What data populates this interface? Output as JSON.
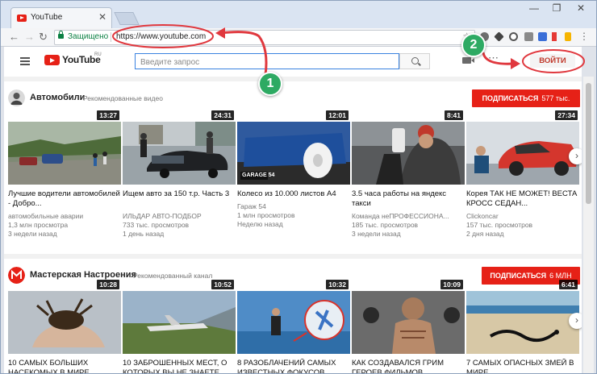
{
  "browser": {
    "tab_title": "YouTube",
    "secure_label": "Защищено",
    "url": "https://www.youtube.com",
    "window_controls": [
      "—",
      "❐",
      "✕"
    ]
  },
  "youtube": {
    "logo_text": "YouTube",
    "logo_region": "RU",
    "search_placeholder": "Введите запрос",
    "signin_label": "ВОЙТИ"
  },
  "sections": [
    {
      "title": "Автомобили",
      "subtitle": "Рекомендованные видео",
      "subscribe_label": "ПОДПИСАТЬСЯ",
      "subscriber_count": "577 тыс.",
      "videos": [
        {
          "title": "Лучшие водители автомобилей - Добро...",
          "channel": "автомобильные аварии",
          "views": "1,3 млн просмотра",
          "age": "3 недели назад",
          "duration": "13:27"
        },
        {
          "title": "Ищем авто за 150 т.р. Часть 3",
          "channel": "ИЛЬДАР АВТО-ПОДБОР",
          "views": "733 тыс. просмотров",
          "age": "1 день назад",
          "duration": "24:31"
        },
        {
          "title": "Колесо из 10.000 листов А4",
          "channel": "Гараж 54",
          "views": "1 млн просмотров",
          "age": "Неделю назад",
          "duration": "12:01"
        },
        {
          "title": "3.5 часа работы на яндекс такси",
          "channel": "Команда неПРОФЕССИОНА...",
          "views": "185 тыс. просмотров",
          "age": "3 недели назад",
          "duration": "8:41"
        },
        {
          "title": "Корея ТАК НЕ МОЖЕТ! ВЕСТА КРОСС СЕДАН...",
          "channel": "Clickoncar",
          "views": "157 тыс. просмотров",
          "age": "2 дня назад",
          "duration": "27:34"
        }
      ]
    },
    {
      "title": "Мастерская Настроения",
      "subtitle": "Рекомендованный канал",
      "subscribe_label": "ПОДПИСАТЬСЯ",
      "subscriber_count": "6 МЛН",
      "videos": [
        {
          "title": "10 САМЫХ БОЛЬШИХ НАСЕКОМЫХ В МИРЕ",
          "duration": "10:28"
        },
        {
          "title": "10 ЗАБРОШЕННЫХ МЕСТ, О КОТОРЫХ ВЫ НЕ ЗНАЕТЕ",
          "duration": "10:52"
        },
        {
          "title": "8 РАЗОБЛАЧЕНИЙ САМЫХ ИЗВЕСТНЫХ ФОКУСОВ",
          "duration": "10:32"
        },
        {
          "title": "КАК СОЗДАВАЛСЯ ГРИМ ГЕРОЕВ ФИЛЬМОВ",
          "duration": "10:09"
        },
        {
          "title": "7 САМЫХ ОПАСНЫХ ЗМЕЙ В МИРЕ",
          "duration": "6:41"
        }
      ]
    }
  ],
  "annotations": {
    "step1": "1",
    "step2": "2",
    "color": "#e0383e",
    "badge_color": "#2eaa63"
  },
  "icons": [
    "menu-icon",
    "search-icon",
    "upload-icon",
    "apps-icon",
    "star-icon",
    "lock-icon",
    "chevron-right-icon"
  ]
}
